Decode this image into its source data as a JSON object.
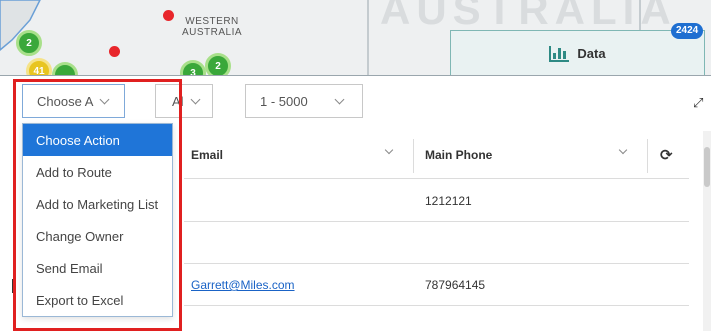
{
  "map": {
    "region_label_line1": "WESTERN",
    "region_label_line2": "AUSTRALIA",
    "background_word": "AUSTRALIA",
    "clusters": [
      {
        "label": "2",
        "color": "green"
      },
      {
        "label": "41",
        "color": "yellow"
      },
      {
        "label": "3",
        "color": "green"
      },
      {
        "label": "2",
        "color": "green"
      }
    ]
  },
  "data_tab": {
    "label": "Data",
    "count": "2424",
    "icon": "bar-chart-icon"
  },
  "toolbar": {
    "action_select": {
      "value": "Choose A"
    },
    "filter_select": {
      "value": "Al"
    },
    "range_select": {
      "value": "1 - 5000"
    },
    "expand_icon": "expand-icon"
  },
  "action_menu": {
    "items": [
      "Choose Action",
      "Add to Route",
      "Add to Marketing List",
      "Change Owner",
      "Send Email",
      "Export to Excel"
    ],
    "selected_index": 0
  },
  "table": {
    "columns": [
      "Email",
      "Main Phone"
    ],
    "rows": [
      {
        "email": "",
        "phone": "1212121"
      },
      {
        "email": "",
        "phone": ""
      },
      {
        "email": "Garrett@Miles.com",
        "phone": "787964145"
      }
    ],
    "refresh_icon": "refresh-icon"
  },
  "colors": {
    "accent": "#1f75d8",
    "highlight": "#e02020",
    "cluster_green": "#3aa83a",
    "badge": "#1f6fd1"
  }
}
